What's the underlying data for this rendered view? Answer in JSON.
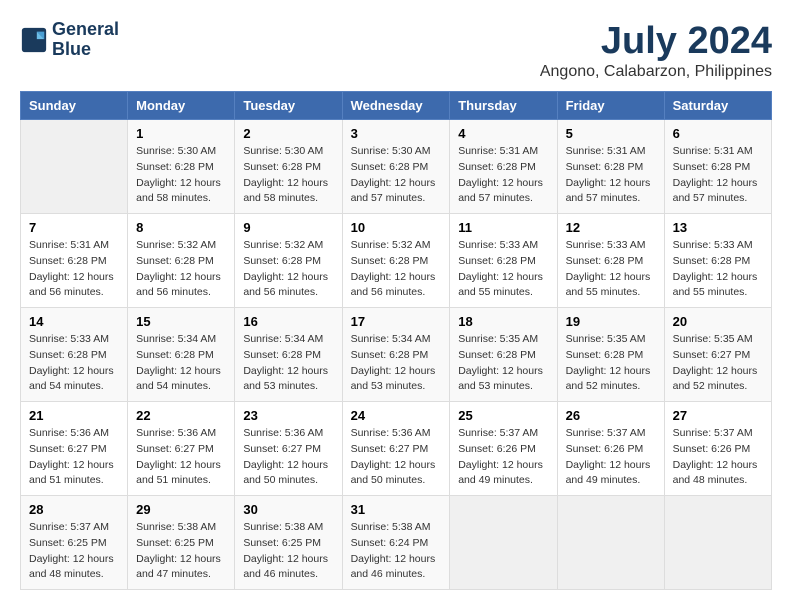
{
  "header": {
    "logo_line1": "General",
    "logo_line2": "Blue",
    "title": "July 2024",
    "subtitle": "Angono, Calabarzon, Philippines"
  },
  "weekdays": [
    "Sunday",
    "Monday",
    "Tuesday",
    "Wednesday",
    "Thursday",
    "Friday",
    "Saturday"
  ],
  "weeks": [
    [
      {
        "day": "",
        "info": ""
      },
      {
        "day": "1",
        "info": "Sunrise: 5:30 AM\nSunset: 6:28 PM\nDaylight: 12 hours\nand 58 minutes."
      },
      {
        "day": "2",
        "info": "Sunrise: 5:30 AM\nSunset: 6:28 PM\nDaylight: 12 hours\nand 58 minutes."
      },
      {
        "day": "3",
        "info": "Sunrise: 5:30 AM\nSunset: 6:28 PM\nDaylight: 12 hours\nand 57 minutes."
      },
      {
        "day": "4",
        "info": "Sunrise: 5:31 AM\nSunset: 6:28 PM\nDaylight: 12 hours\nand 57 minutes."
      },
      {
        "day": "5",
        "info": "Sunrise: 5:31 AM\nSunset: 6:28 PM\nDaylight: 12 hours\nand 57 minutes."
      },
      {
        "day": "6",
        "info": "Sunrise: 5:31 AM\nSunset: 6:28 PM\nDaylight: 12 hours\nand 57 minutes."
      }
    ],
    [
      {
        "day": "7",
        "info": "Sunrise: 5:31 AM\nSunset: 6:28 PM\nDaylight: 12 hours\nand 56 minutes."
      },
      {
        "day": "8",
        "info": "Sunrise: 5:32 AM\nSunset: 6:28 PM\nDaylight: 12 hours\nand 56 minutes."
      },
      {
        "day": "9",
        "info": "Sunrise: 5:32 AM\nSunset: 6:28 PM\nDaylight: 12 hours\nand 56 minutes."
      },
      {
        "day": "10",
        "info": "Sunrise: 5:32 AM\nSunset: 6:28 PM\nDaylight: 12 hours\nand 56 minutes."
      },
      {
        "day": "11",
        "info": "Sunrise: 5:33 AM\nSunset: 6:28 PM\nDaylight: 12 hours\nand 55 minutes."
      },
      {
        "day": "12",
        "info": "Sunrise: 5:33 AM\nSunset: 6:28 PM\nDaylight: 12 hours\nand 55 minutes."
      },
      {
        "day": "13",
        "info": "Sunrise: 5:33 AM\nSunset: 6:28 PM\nDaylight: 12 hours\nand 55 minutes."
      }
    ],
    [
      {
        "day": "14",
        "info": "Sunrise: 5:33 AM\nSunset: 6:28 PM\nDaylight: 12 hours\nand 54 minutes."
      },
      {
        "day": "15",
        "info": "Sunrise: 5:34 AM\nSunset: 6:28 PM\nDaylight: 12 hours\nand 54 minutes."
      },
      {
        "day": "16",
        "info": "Sunrise: 5:34 AM\nSunset: 6:28 PM\nDaylight: 12 hours\nand 53 minutes."
      },
      {
        "day": "17",
        "info": "Sunrise: 5:34 AM\nSunset: 6:28 PM\nDaylight: 12 hours\nand 53 minutes."
      },
      {
        "day": "18",
        "info": "Sunrise: 5:35 AM\nSunset: 6:28 PM\nDaylight: 12 hours\nand 53 minutes."
      },
      {
        "day": "19",
        "info": "Sunrise: 5:35 AM\nSunset: 6:28 PM\nDaylight: 12 hours\nand 52 minutes."
      },
      {
        "day": "20",
        "info": "Sunrise: 5:35 AM\nSunset: 6:27 PM\nDaylight: 12 hours\nand 52 minutes."
      }
    ],
    [
      {
        "day": "21",
        "info": "Sunrise: 5:36 AM\nSunset: 6:27 PM\nDaylight: 12 hours\nand 51 minutes."
      },
      {
        "day": "22",
        "info": "Sunrise: 5:36 AM\nSunset: 6:27 PM\nDaylight: 12 hours\nand 51 minutes."
      },
      {
        "day": "23",
        "info": "Sunrise: 5:36 AM\nSunset: 6:27 PM\nDaylight: 12 hours\nand 50 minutes."
      },
      {
        "day": "24",
        "info": "Sunrise: 5:36 AM\nSunset: 6:27 PM\nDaylight: 12 hours\nand 50 minutes."
      },
      {
        "day": "25",
        "info": "Sunrise: 5:37 AM\nSunset: 6:26 PM\nDaylight: 12 hours\nand 49 minutes."
      },
      {
        "day": "26",
        "info": "Sunrise: 5:37 AM\nSunset: 6:26 PM\nDaylight: 12 hours\nand 49 minutes."
      },
      {
        "day": "27",
        "info": "Sunrise: 5:37 AM\nSunset: 6:26 PM\nDaylight: 12 hours\nand 48 minutes."
      }
    ],
    [
      {
        "day": "28",
        "info": "Sunrise: 5:37 AM\nSunset: 6:25 PM\nDaylight: 12 hours\nand 48 minutes."
      },
      {
        "day": "29",
        "info": "Sunrise: 5:38 AM\nSunset: 6:25 PM\nDaylight: 12 hours\nand 47 minutes."
      },
      {
        "day": "30",
        "info": "Sunrise: 5:38 AM\nSunset: 6:25 PM\nDaylight: 12 hours\nand 46 minutes."
      },
      {
        "day": "31",
        "info": "Sunrise: 5:38 AM\nSunset: 6:24 PM\nDaylight: 12 hours\nand 46 minutes."
      },
      {
        "day": "",
        "info": ""
      },
      {
        "day": "",
        "info": ""
      },
      {
        "day": "",
        "info": ""
      }
    ]
  ]
}
